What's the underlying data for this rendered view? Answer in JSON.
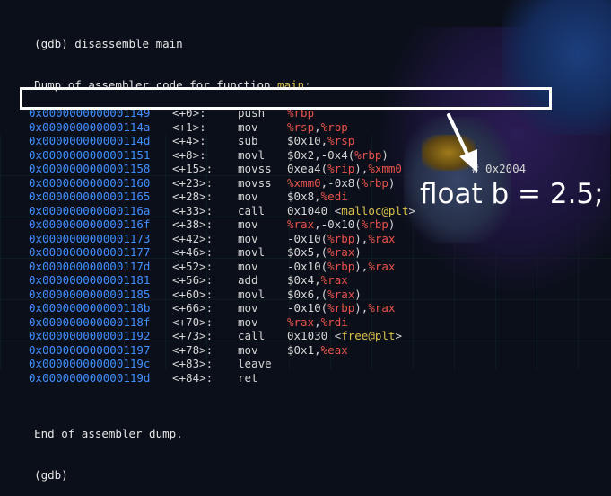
{
  "header": {
    "cmd_line": "(gdb) disassemble main",
    "dump_prefix": "Dump of assembler code for function ",
    "function_name": "main",
    "dump_suffix": ":"
  },
  "instructions": [
    {
      "addr": "0x0000000000001149",
      "off": "<+0>:",
      "mn": "push",
      "ops": [
        {
          "t": "%rbp",
          "c": "reg"
        }
      ]
    },
    {
      "addr": "0x000000000000114a",
      "off": "<+1>:",
      "mn": "mov",
      "ops": [
        {
          "t": "%rsp",
          "c": "reg"
        },
        {
          "t": ","
        },
        {
          "t": "%rbp",
          "c": "reg"
        }
      ]
    },
    {
      "addr": "0x000000000000114d",
      "off": "<+4>:",
      "mn": "sub",
      "ops": [
        {
          "t": "$0x10,"
        },
        {
          "t": "%rsp",
          "c": "reg"
        }
      ]
    },
    {
      "addr": "0x0000000000001151",
      "off": "<+8>:",
      "mn": "movl",
      "ops": [
        {
          "t": "$0x2,-0x4("
        },
        {
          "t": "%rbp",
          "c": "reg"
        },
        {
          "t": ")"
        }
      ]
    },
    {
      "addr": "0x0000000000001158",
      "off": "<+15>:",
      "mn": "movss",
      "ops": [
        {
          "t": "0xea4("
        },
        {
          "t": "%rip",
          "c": "reg"
        },
        {
          "t": "),"
        },
        {
          "t": "%xmm0",
          "c": "reg"
        }
      ],
      "comment": "# 0x2004"
    },
    {
      "addr": "0x0000000000001160",
      "off": "<+23>:",
      "mn": "movss",
      "ops": [
        {
          "t": "%xmm0",
          "c": "reg"
        },
        {
          "t": ",-0x8("
        },
        {
          "t": "%rbp",
          "c": "reg"
        },
        {
          "t": ")"
        }
      ]
    },
    {
      "addr": "0x0000000000001165",
      "off": "<+28>:",
      "mn": "mov",
      "ops": [
        {
          "t": "$0x8,"
        },
        {
          "t": "%edi",
          "c": "reg"
        }
      ]
    },
    {
      "addr": "0x000000000000116a",
      "off": "<+33>:",
      "mn": "call",
      "ops": [
        {
          "t": "0x1040 <"
        },
        {
          "t": "malloc@plt",
          "c": "sym"
        },
        {
          "t": ">"
        }
      ]
    },
    {
      "addr": "0x000000000000116f",
      "off": "<+38>:",
      "mn": "mov",
      "ops": [
        {
          "t": "%rax",
          "c": "reg"
        },
        {
          "t": ",-0x10("
        },
        {
          "t": "%rbp",
          "c": "reg"
        },
        {
          "t": ")"
        }
      ]
    },
    {
      "addr": "0x0000000000001173",
      "off": "<+42>:",
      "mn": "mov",
      "ops": [
        {
          "t": "-0x10("
        },
        {
          "t": "%rbp",
          "c": "reg"
        },
        {
          "t": "),"
        },
        {
          "t": "%rax",
          "c": "reg"
        }
      ]
    },
    {
      "addr": "0x0000000000001177",
      "off": "<+46>:",
      "mn": "movl",
      "ops": [
        {
          "t": "$0x5,("
        },
        {
          "t": "%rax",
          "c": "reg"
        },
        {
          "t": ")"
        }
      ]
    },
    {
      "addr": "0x000000000000117d",
      "off": "<+52>:",
      "mn": "mov",
      "ops": [
        {
          "t": "-0x10("
        },
        {
          "t": "%rbp",
          "c": "reg"
        },
        {
          "t": "),"
        },
        {
          "t": "%rax",
          "c": "reg"
        }
      ]
    },
    {
      "addr": "0x0000000000001181",
      "off": "<+56>:",
      "mn": "add",
      "ops": [
        {
          "t": "$0x4,"
        },
        {
          "t": "%rax",
          "c": "reg"
        }
      ]
    },
    {
      "addr": "0x0000000000001185",
      "off": "<+60>:",
      "mn": "movl",
      "ops": [
        {
          "t": "$0x6,("
        },
        {
          "t": "%rax",
          "c": "reg"
        },
        {
          "t": ")"
        }
      ]
    },
    {
      "addr": "0x000000000000118b",
      "off": "<+66>:",
      "mn": "mov",
      "ops": [
        {
          "t": "-0x10("
        },
        {
          "t": "%rbp",
          "c": "reg"
        },
        {
          "t": "),"
        },
        {
          "t": "%rax",
          "c": "reg"
        }
      ]
    },
    {
      "addr": "0x000000000000118f",
      "off": "<+70>:",
      "mn": "mov",
      "ops": [
        {
          "t": "%rax",
          "c": "reg"
        },
        {
          "t": ","
        },
        {
          "t": "%rdi",
          "c": "reg"
        }
      ]
    },
    {
      "addr": "0x0000000000001192",
      "off": "<+73>:",
      "mn": "call",
      "ops": [
        {
          "t": "0x1030 <"
        },
        {
          "t": "free@plt",
          "c": "sym"
        },
        {
          "t": ">"
        }
      ]
    },
    {
      "addr": "0x0000000000001197",
      "off": "<+78>:",
      "mn": "mov",
      "ops": [
        {
          "t": "$0x1,"
        },
        {
          "t": "%eax",
          "c": "reg"
        }
      ]
    },
    {
      "addr": "0x000000000000119c",
      "off": "<+83>:",
      "mn": "leave",
      "ops": []
    },
    {
      "addr": "0x000000000000119d",
      "off": "<+84>:",
      "mn": "ret",
      "ops": []
    }
  ],
  "footer": {
    "end_line": "End of assembler dump.",
    "prompt_partial": "(gdb)"
  },
  "annotation": {
    "text": "float b = 2.5;",
    "box_color": "#ffffff"
  },
  "colors": {
    "address": "#3f8fff",
    "register": "#e8524a",
    "symbol": "#d9c14a",
    "text": "#d6d6d6",
    "background": "#0b0f1a"
  }
}
